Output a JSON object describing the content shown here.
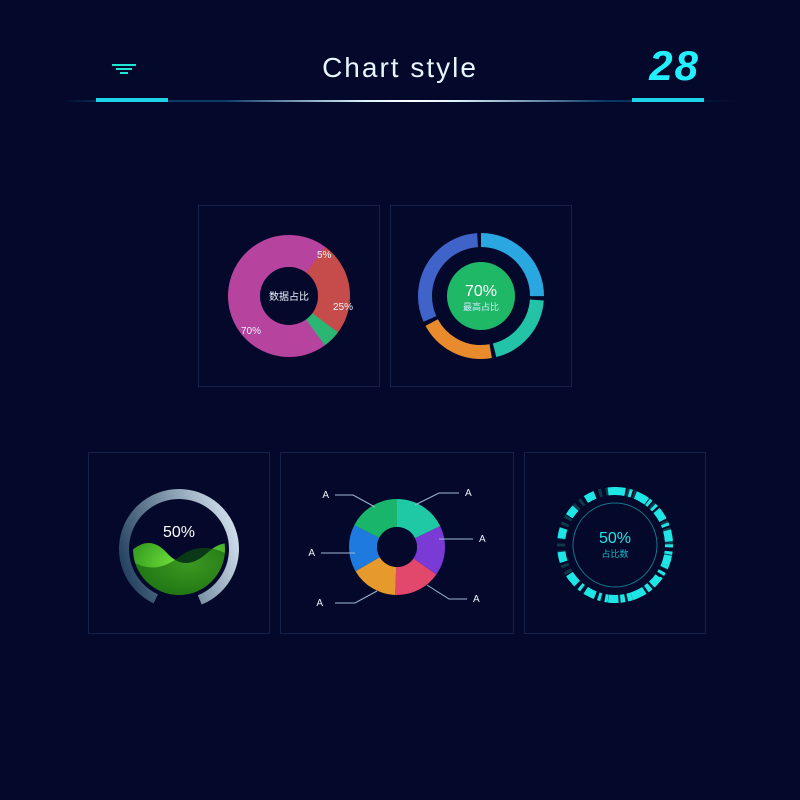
{
  "header": {
    "title": "Chart style",
    "number": "28"
  },
  "charts": {
    "donut1": {
      "center_label": "数据占比",
      "slice_labels": [
        "5%",
        "25%",
        "70%"
      ]
    },
    "donut2": {
      "center_value": "70%",
      "center_label": "最高占比"
    },
    "gauge3": {
      "value": "50%"
    },
    "donut4": {
      "labels": [
        "A",
        "A",
        "A",
        "A",
        "A",
        "A"
      ]
    },
    "gauge5": {
      "value": "50%",
      "label": "占比数"
    }
  },
  "chart_data": [
    {
      "type": "pie",
      "title": "数据占比",
      "series": [
        {
          "name": "",
          "values": [
            5,
            25,
            70
          ]
        }
      ],
      "labels": [
        "5%",
        "25%",
        "70%"
      ],
      "colors": [
        "#2bb673",
        "#d14e4e",
        "#b6449f"
      ]
    },
    {
      "type": "pie",
      "title": "最高占比",
      "center_value": 70,
      "series": [
        {
          "name": "outer",
          "values": [
            25,
            25,
            20,
            30
          ]
        },
        {
          "name": "inner_highlight",
          "values": [
            70,
            30
          ]
        }
      ],
      "colors_outer": [
        "#2aa7e0",
        "#22c3a6",
        "#e88b2d",
        "#4265c9"
      ],
      "colors_inner": [
        "#1fb866",
        "#0a1540"
      ]
    },
    {
      "type": "pie",
      "title": "",
      "center_value": 50,
      "style": "gauge-fill",
      "series": [
        {
          "name": "progress",
          "values": [
            50,
            50
          ]
        }
      ]
    },
    {
      "type": "pie",
      "title": "",
      "series": [
        {
          "name": "",
          "values": [
            18,
            18,
            16,
            16,
            16,
            16
          ]
        }
      ],
      "labels": [
        "A",
        "A",
        "A",
        "A",
        "A",
        "A"
      ],
      "colors": [
        "#1fc9a5",
        "#7a3ad6",
        "#e1486c",
        "#e69a2b",
        "#1f7ae0",
        "#18b56b"
      ]
    },
    {
      "type": "pie",
      "title": "占比数",
      "center_value": 50,
      "style": "dotted-gauge",
      "series": [
        {
          "name": "progress",
          "values": [
            50,
            50
          ]
        }
      ]
    }
  ]
}
